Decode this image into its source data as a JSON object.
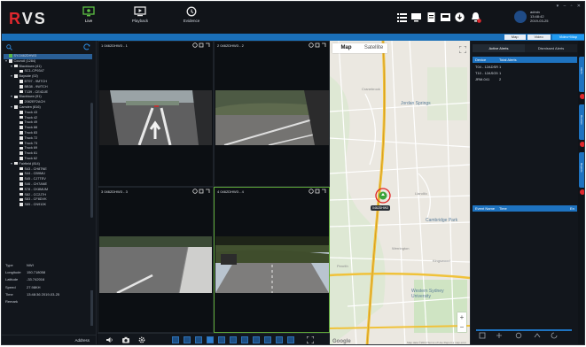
{
  "app": {
    "logo_r": "R",
    "logo_vs": "VS",
    "nav": [
      {
        "label": "Live",
        "icon": "live-monitor-icon"
      },
      {
        "label": "Playback",
        "icon": "playback-icon"
      },
      {
        "label": "Evidence",
        "icon": "evidence-icon"
      }
    ],
    "window_controls": "▾ – ▫ ✕",
    "toolbar_icons": [
      "list-icon",
      "monitor-icon",
      "report-icon",
      "device-icon",
      "download-icon",
      "alarm-icon"
    ],
    "user": {
      "name": "admin",
      "time": "13:48:42",
      "date": "2019-03-25"
    },
    "accent": "#1a6fb8",
    "brand_red": "#e0282e"
  },
  "map_view_tabs": [
    "Map",
    "Video",
    "Video+Map"
  ],
  "sidebar": {
    "tree": [
      {
        "label": "SY-0462DHW3",
        "level": 0,
        "highlight": true,
        "check": "green"
      },
      {
        "label": "Council (1284)",
        "level": 0,
        "toggle": "▾"
      },
      {
        "label": "Blacktown (41)",
        "level": 1,
        "toggle": "▾"
      },
      {
        "label": "SC1-CP9347",
        "level": 2
      },
      {
        "label": "Bayside (02)",
        "level": 1,
        "toggle": "▾"
      },
      {
        "label": "BT97 - 9MTCH",
        "level": 2
      },
      {
        "label": "BB38 - 9WTCH",
        "level": 2
      },
      {
        "label": "T139 - CE4DJE",
        "level": 2
      },
      {
        "label": "Blacktown (91)",
        "level": 1,
        "toggle": "▾"
      },
      {
        "label": "2082EF2ACH",
        "level": 2
      },
      {
        "label": "Camden (816)",
        "level": 1,
        "toggle": "▾"
      },
      {
        "label": "Truck 43",
        "level": 2
      },
      {
        "label": "Truck 42",
        "level": 2
      },
      {
        "label": "Truck 49",
        "level": 2
      },
      {
        "label": "Truck 88",
        "level": 2
      },
      {
        "label": "Truck 83",
        "level": 2
      },
      {
        "label": "Truck 72",
        "level": 2
      },
      {
        "label": "Truck 73",
        "level": 2
      },
      {
        "label": "Truck 69",
        "level": 2
      },
      {
        "label": "Truck 61",
        "level": 2
      },
      {
        "label": "Truck 62",
        "level": 2
      },
      {
        "label": "Fairfield (814)",
        "level": 1,
        "toggle": "▾"
      },
      {
        "label": "S43 - CH8TNE",
        "level": 2
      },
      {
        "label": "S44 - CB9MU",
        "level": 2
      },
      {
        "label": "S45 - CJ7TEV",
        "level": 2
      },
      {
        "label": "S46 - CH7ANE",
        "level": 2
      },
      {
        "label": "S78 - CK8MUM",
        "level": 2
      },
      {
        "label": "S82 - CC2J7H",
        "level": 2
      },
      {
        "label": "S83 - CF8DVK",
        "level": 2
      },
      {
        "label": "S85 - CN910K",
        "level": 2
      }
    ],
    "info": [
      {
        "key": "Type",
        "value": "NWI"
      },
      {
        "key": "Longitude",
        "value": "150.718058"
      },
      {
        "key": "Latitude",
        "value": "-33.742016"
      },
      {
        "key": "Speed",
        "value": "27.98KH"
      },
      {
        "key": "Time",
        "value": "13:48:36 2019-03-25"
      },
      {
        "key": "Remark",
        "value": ""
      }
    ],
    "address_label": "Address"
  },
  "videos": [
    {
      "title": "1 0462DHW3 - 1"
    },
    {
      "title": "2 0462DHW3 - 2"
    },
    {
      "title": "3 0462DHW3 - 3"
    },
    {
      "title": "4 0462DHW3 - 4"
    }
  ],
  "video_toolbar_icons": [
    "volume-icon",
    "snapshot-icon",
    "settings-icon"
  ],
  "map": {
    "type_tabs": [
      "Map",
      "Satellite"
    ],
    "labels": [
      {
        "text": "Cranebrook",
        "big": false
      },
      {
        "text": "Jordan Springs",
        "big": true
      },
      {
        "text": "Llandilo",
        "big": false
      },
      {
        "text": "Cambridge Park",
        "big": true
      },
      {
        "text": "Werrington",
        "big": false
      },
      {
        "text": "Kingswood",
        "big": false
      },
      {
        "text": "Western Sydney University",
        "big": true
      },
      {
        "text": "Penrith",
        "big": false
      }
    ],
    "vehicle_label": "0462DHW3",
    "google": "Google",
    "footer": "Map data ©2019   Terms of Use   Report a map error"
  },
  "right_panel": {
    "tabs": [
      "Active Alerts",
      "Dismissed Alerts"
    ],
    "columns": [
      "Device",
      "Total Alerts"
    ],
    "rows": [
      {
        "device": "T04 - 12ADSR",
        "total": "1"
      },
      {
        "device": "T10 - 12ASG5",
        "total": "1"
      },
      {
        "device": "JRM-041",
        "total": "2"
      }
    ],
    "event_columns": [
      "Event Name",
      "Time",
      "En"
    ]
  },
  "side_tabs": [
    "Alerts",
    "Devices",
    "Reports"
  ]
}
